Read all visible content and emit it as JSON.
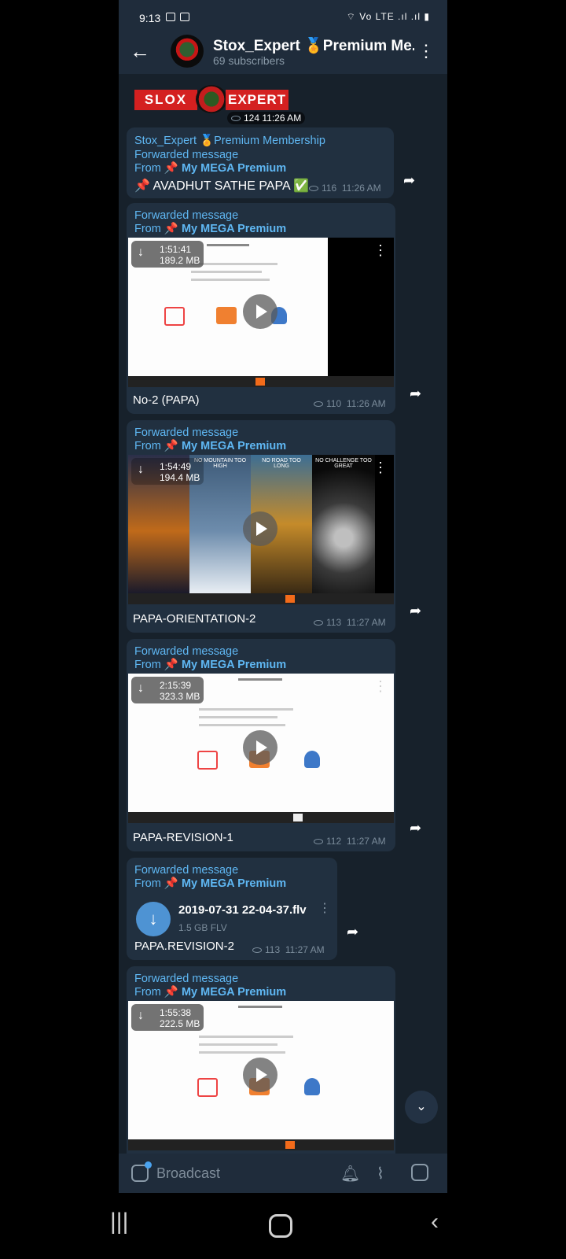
{
  "status_bar": {
    "time": "9:13",
    "right": "⌔ Vo LTE .ıl .ıl ▮"
  },
  "header": {
    "title": "Stox_Expert 🏅Premium Me...",
    "subscribers": "69 subscribers"
  },
  "logo_post": {
    "logo_left": "SLOX",
    "logo_right": "EXPERT",
    "views": "124",
    "time": "11:26 AM"
  },
  "messages": [
    {
      "sender": "Stox_Expert 🏅Premium Membership",
      "forwarded": "Forwarded message",
      "from_prefix": "From ",
      "from_pin": "📌",
      "from_name": " My MEGA Premium",
      "text": "📌 AVADHUT SATHE PAPA ✅",
      "views": "116",
      "time": "11:26 AM"
    },
    {
      "forwarded": "Forwarded message",
      "from_prefix": "From ",
      "from_pin": "📌",
      "from_name": " My MEGA Premium",
      "duration": "1:51:41",
      "size": "189.2 MB",
      "caption": "No-2 (PAPA)",
      "views": "110",
      "time": "11:26 AM"
    },
    {
      "forwarded": "Forwarded message",
      "from_prefix": "From ",
      "from_pin": "📌",
      "from_name": " My MEGA Premium",
      "duration": "1:54:49",
      "size": "194.4 MB",
      "panels": [
        "",
        "NO MOUNTAIN TOO HIGH",
        "NO ROAD TOO LONG",
        "NO CHALLENGE TOO GREAT"
      ],
      "caption": "PAPA-ORIENTATION-2",
      "views": "113",
      "time": "11:27 AM"
    },
    {
      "forwarded": "Forwarded message",
      "from_prefix": "From ",
      "from_pin": "📌",
      "from_name": " My MEGA Premium",
      "duration": "2:15:39",
      "size": "323.3 MB",
      "caption": "PAPA-REVISION-1",
      "views": "112",
      "time": "11:27 AM"
    },
    {
      "forwarded": "Forwarded message",
      "from_prefix": "From ",
      "from_pin": "📌",
      "from_name": " My MEGA Premium",
      "file_name": "2019-07-31 22-04-37.flv",
      "file_info": "1.5 GB FLV",
      "caption": "PAPA.REVISION-2",
      "views": "113",
      "time": "11:27 AM"
    },
    {
      "forwarded": "Forwarded message",
      "from_prefix": "From ",
      "from_pin": "📌",
      "from_name": " My MEGA Premium",
      "duration": "1:55:38",
      "size": "222.5 MB"
    }
  ],
  "input": {
    "placeholder": "Broadcast"
  },
  "colors": {
    "accent": "#5fb7f3",
    "bubble": "#213040",
    "background": "#17212b",
    "header": "#1f2c3b"
  }
}
